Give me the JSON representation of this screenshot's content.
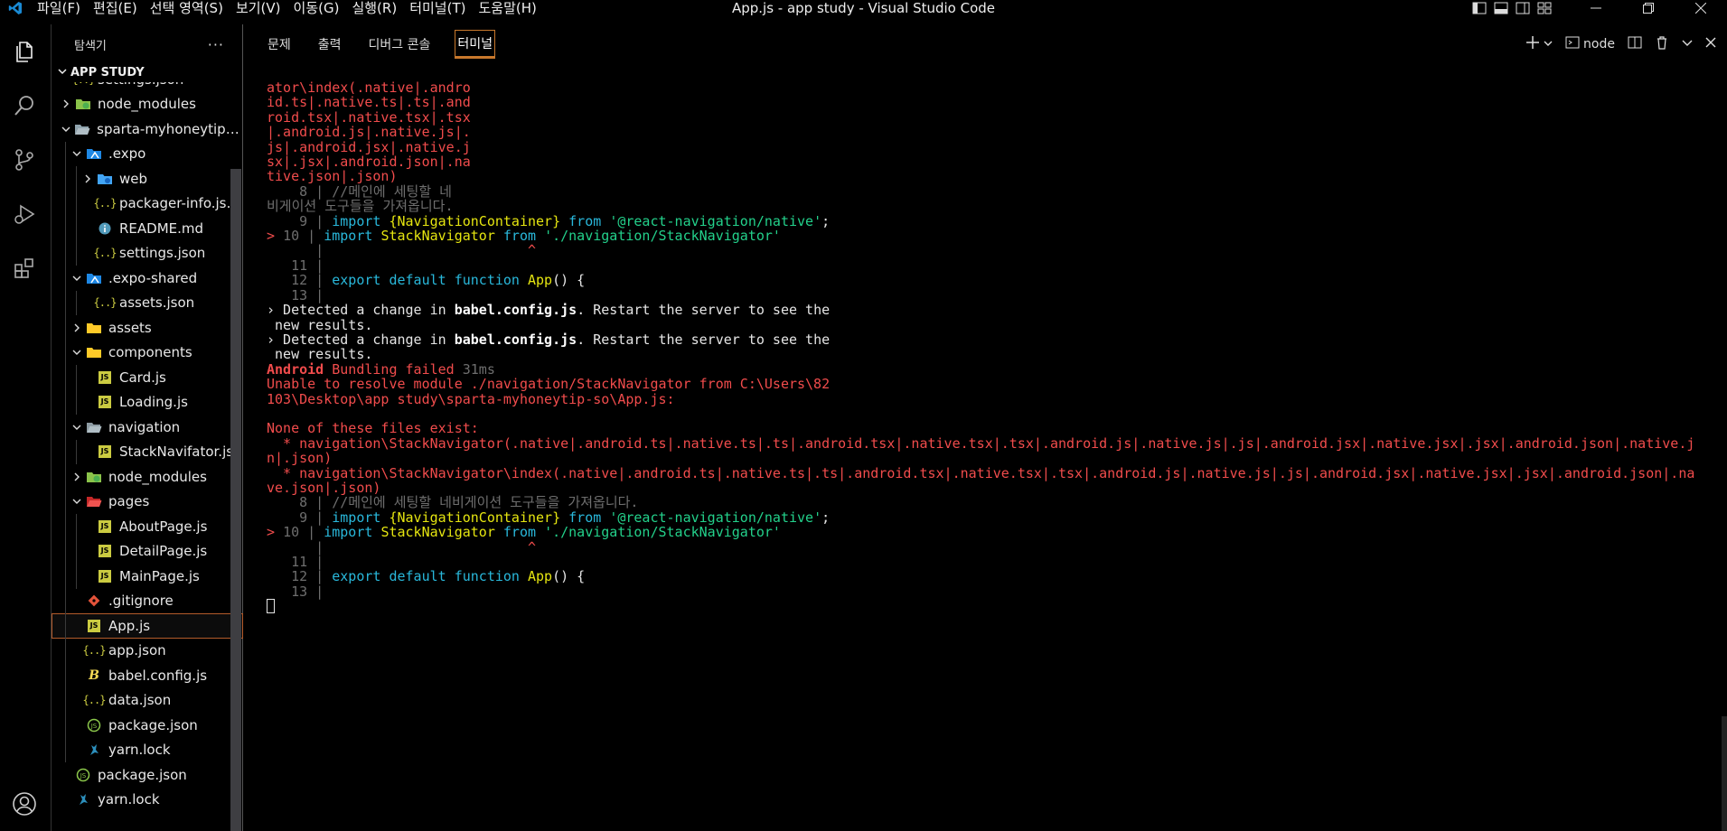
{
  "window": {
    "title": "App.js - app study - Visual Studio Code",
    "menu": [
      "파일(F)",
      "편집(E)",
      "선택 영역(S)",
      "보기(V)",
      "이동(G)",
      "실행(R)",
      "터미널(T)",
      "도움말(H)"
    ]
  },
  "sidebar": {
    "title": "탐색기",
    "more": "···",
    "section": "APP STUDY",
    "items": [
      {
        "label": "settings.json",
        "depth": 1,
        "chev": "",
        "icon": "json"
      },
      {
        "label": "node_modules",
        "depth": 1,
        "chev": "closed",
        "icon": "folder-green"
      },
      {
        "label": "sparta-myhoneytip-so",
        "depth": 1,
        "chev": "open",
        "icon": "folder-open"
      },
      {
        "label": ".expo",
        "depth": 2,
        "chev": "open",
        "icon": "folder-expo"
      },
      {
        "label": "web",
        "depth": 3,
        "chev": "closed",
        "icon": "folder-blue"
      },
      {
        "label": "packager-info.json",
        "depth": 3,
        "chev": "",
        "icon": "json"
      },
      {
        "label": "README.md",
        "depth": 3,
        "chev": "",
        "icon": "info"
      },
      {
        "label": "settings.json",
        "depth": 3,
        "chev": "",
        "icon": "json"
      },
      {
        "label": ".expo-shared",
        "depth": 2,
        "chev": "open",
        "icon": "folder-expo"
      },
      {
        "label": "assets.json",
        "depth": 3,
        "chev": "",
        "icon": "json"
      },
      {
        "label": "assets",
        "depth": 2,
        "chev": "closed",
        "icon": "folder-yellow"
      },
      {
        "label": "components",
        "depth": 2,
        "chev": "open",
        "icon": "folder-yellow"
      },
      {
        "label": "Card.js",
        "depth": 3,
        "chev": "",
        "icon": "js"
      },
      {
        "label": "Loading.js",
        "depth": 3,
        "chev": "",
        "icon": "js"
      },
      {
        "label": "navigation",
        "depth": 2,
        "chev": "open",
        "icon": "folder-grey"
      },
      {
        "label": "StackNavifator.js",
        "depth": 3,
        "chev": "",
        "icon": "js"
      },
      {
        "label": "node_modules",
        "depth": 2,
        "chev": "closed",
        "icon": "folder-green"
      },
      {
        "label": "pages",
        "depth": 2,
        "chev": "open",
        "icon": "folder-red"
      },
      {
        "label": "AboutPage.js",
        "depth": 3,
        "chev": "",
        "icon": "js"
      },
      {
        "label": "DetailPage.js",
        "depth": 3,
        "chev": "",
        "icon": "js"
      },
      {
        "label": "MainPage.js",
        "depth": 3,
        "chev": "",
        "icon": "js"
      },
      {
        "label": ".gitignore",
        "depth": 2,
        "chev": "",
        "icon": "git"
      },
      {
        "label": "App.js",
        "depth": 2,
        "chev": "",
        "icon": "js",
        "selected": true
      },
      {
        "label": "app.json",
        "depth": 2,
        "chev": "",
        "icon": "json"
      },
      {
        "label": "babel.config.js",
        "depth": 2,
        "chev": "",
        "icon": "babel"
      },
      {
        "label": "data.json",
        "depth": 2,
        "chev": "",
        "icon": "json"
      },
      {
        "label": "package.json",
        "depth": 2,
        "chev": "",
        "icon": "npm"
      },
      {
        "label": "yarn.lock",
        "depth": 2,
        "chev": "",
        "icon": "yarn"
      },
      {
        "label": "package.json",
        "depth": 1,
        "chev": "",
        "icon": "npm"
      },
      {
        "label": "yarn.lock",
        "depth": 1,
        "chev": "",
        "icon": "yarn"
      }
    ]
  },
  "panel": {
    "tabs": [
      {
        "label": "문제",
        "active": false
      },
      {
        "label": "출력",
        "active": false
      },
      {
        "label": "디버그 콘솔",
        "active": false
      },
      {
        "label": "터미널",
        "active": true
      }
    ],
    "terminal_name": "node"
  },
  "terminal": {
    "lines": [
      [
        [
          "r",
          "ator\\index(.native|.andro"
        ]
      ],
      [
        [
          "r",
          "id.ts|.native.ts|.ts|.and"
        ]
      ],
      [
        [
          "r",
          "roid.tsx|.native.tsx|.tsx"
        ]
      ],
      [
        [
          "r",
          "|.android.js|.native.js|."
        ]
      ],
      [
        [
          "r",
          "js|.android.jsx|.native.j"
        ]
      ],
      [
        [
          "r",
          "sx|.jsx|.android.json|.na"
        ]
      ],
      [
        [
          "r",
          "tive.json|.json)"
        ]
      ],
      [
        [
          "g",
          "    8 | //메인에 세팅할 네"
        ]
      ],
      [
        [
          "g",
          "비게이션 도구들을 가져옵니다."
        ]
      ],
      [
        [
          "g",
          "    9 | "
        ],
        [
          "c",
          "import "
        ],
        [
          "y",
          "{NavigationContainer}"
        ],
        [
          "c",
          " from "
        ],
        [
          "gr",
          "'@react-navigation/native'"
        ],
        [
          "w",
          ";"
        ]
      ],
      [
        [
          "r",
          "> "
        ],
        [
          "g",
          "10 | "
        ],
        [
          "c",
          "import "
        ],
        [
          "y",
          "StackNavigator"
        ],
        [
          "c",
          " from "
        ],
        [
          "gr",
          "'./navigation/StackNavigator'"
        ]
      ],
      [
        [
          "g",
          "      |                         "
        ],
        [
          "r",
          "^"
        ]
      ],
      [
        [
          "g",
          "   11 |"
        ]
      ],
      [
        [
          "g",
          "   12 | "
        ],
        [
          "c",
          "export default function "
        ],
        [
          "y",
          "App"
        ],
        [
          "w",
          "() {"
        ]
      ],
      [
        [
          "g",
          "   13 |"
        ]
      ],
      [
        [
          "w",
          "› Detected a change in "
        ],
        [
          "wb",
          "babel.config.js"
        ],
        [
          "w",
          ". Restart the server to see the"
        ]
      ],
      [
        [
          "w",
          " new results."
        ]
      ],
      [
        [
          "w",
          "› Detected a change in "
        ],
        [
          "wb",
          "babel.config.js"
        ],
        [
          "w",
          ". Restart the server to see the"
        ]
      ],
      [
        [
          "w",
          " new results."
        ]
      ],
      [
        [
          "rb",
          "Android"
        ],
        [
          "r",
          " Bundling failed "
        ],
        [
          "g",
          "31ms"
        ]
      ],
      [
        [
          "r",
          "Unable to resolve module ./navigation/StackNavigator from C:\\Users\\82"
        ]
      ],
      [
        [
          "r",
          "103\\Desktop\\app study\\sparta-myhoneytip-so\\App.js:"
        ]
      ],
      [
        [
          "r",
          " "
        ]
      ],
      [
        [
          "r",
          "None of these files exist:"
        ]
      ],
      [
        [
          "r",
          "  * navigation\\StackNavigator(.native|.android.ts|.native.ts|.ts|.android.tsx|.native.tsx|.tsx|.android.js|.native.js|.js|.android.jsx|.native.jsx|.jsx|.android.json|.native.jso"
        ]
      ],
      [
        [
          "r",
          "n|.json)"
        ]
      ],
      [
        [
          "r",
          "  * navigation\\StackNavigator\\index(.native|.android.ts|.native.ts|.ts|.android.tsx|.native.tsx|.tsx|.android.js|.native.js|.js|.android.jsx|.native.jsx|.jsx|.android.json|.nati"
        ]
      ],
      [
        [
          "r",
          "ve.json|.json)"
        ]
      ],
      [
        [
          "g",
          "    8 | //메인에 세팅할 네비게이션 도구들을 가져옵니다."
        ]
      ],
      [
        [
          "g",
          "    9 | "
        ],
        [
          "c",
          "import "
        ],
        [
          "y",
          "{NavigationContainer}"
        ],
        [
          "c",
          " from "
        ],
        [
          "gr",
          "'@react-navigation/native'"
        ],
        [
          "w",
          ";"
        ]
      ],
      [
        [
          "r",
          "> "
        ],
        [
          "g",
          "10 | "
        ],
        [
          "c",
          "import "
        ],
        [
          "y",
          "StackNavigator"
        ],
        [
          "c",
          " from "
        ],
        [
          "gr",
          "'./navigation/StackNavigator'"
        ]
      ],
      [
        [
          "g",
          "      |                         "
        ],
        [
          "r",
          "^"
        ]
      ],
      [
        [
          "g",
          "   11 |"
        ]
      ],
      [
        [
          "g",
          "   12 | "
        ],
        [
          "c",
          "export default function "
        ],
        [
          "y",
          "App"
        ],
        [
          "w",
          "() {"
        ]
      ],
      [
        [
          "g",
          "   13 |"
        ]
      ]
    ]
  }
}
